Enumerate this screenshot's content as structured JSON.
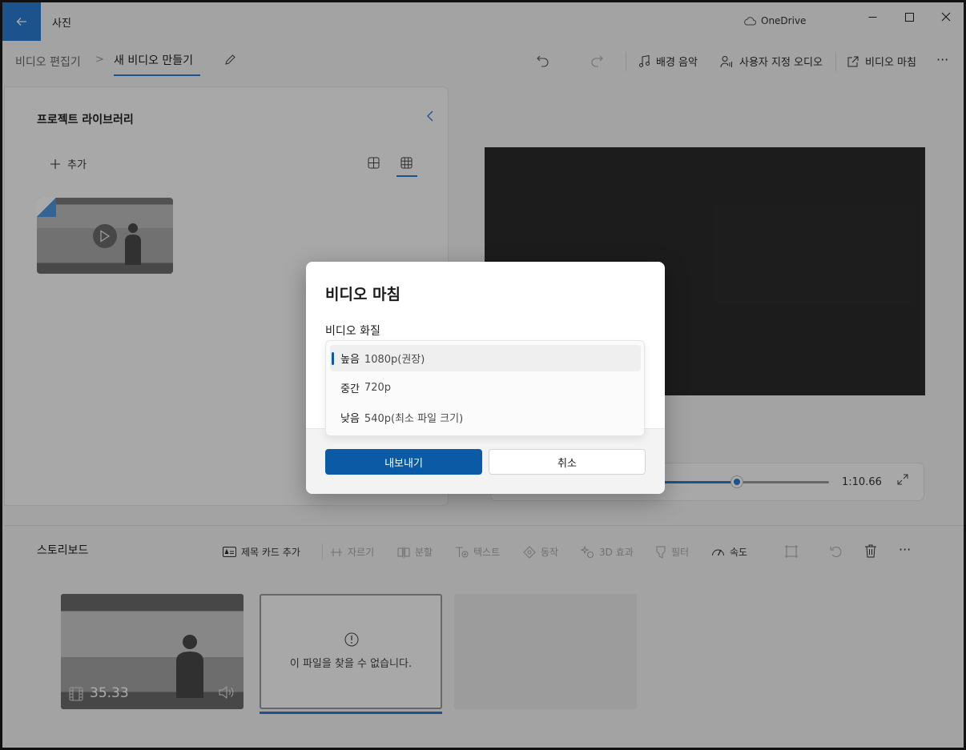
{
  "titlebar": {
    "app_title": "사진",
    "onedrive_label": "OneDrive"
  },
  "command_bar": {
    "breadcrumb_parent": "비디오 편집기",
    "breadcrumb_separator": ">",
    "breadcrumb_current": "새 비디오 만들기",
    "background_music": "배경 음악",
    "custom_audio": "사용자 지정 오디오",
    "finish_video": "비디오 마침",
    "more": "···"
  },
  "library": {
    "title": "프로젝트 라이브러리",
    "add_label": "추가"
  },
  "player": {
    "time": "1:10.66",
    "progress": 0.48
  },
  "storyboard": {
    "title": "스토리보드",
    "tools": {
      "title_card": "제목 카드 추가",
      "trim": "자르기",
      "split": "분할",
      "text": "텍스트",
      "motion": "동작",
      "effects_3d": "3D 효과",
      "filters": "필터",
      "speed": "속도",
      "more": "···"
    },
    "clips": [
      {
        "duration": "35.33"
      },
      {
        "message": "이 파일을 찾을 수 없습니다."
      }
    ]
  },
  "dialog": {
    "title": "비디오 마침",
    "quality_label": "비디오 화질",
    "options": [
      {
        "name": "높음",
        "desc": "1080p(권장)"
      },
      {
        "name": "중간",
        "desc": "720p"
      },
      {
        "name": "낮음",
        "desc": "540p(최소 파일 크기)"
      }
    ],
    "export_label": "내보내기",
    "cancel_label": "취소"
  },
  "colors": {
    "accent": "#2b7cd3",
    "primary_button": "#0b5aa6"
  }
}
